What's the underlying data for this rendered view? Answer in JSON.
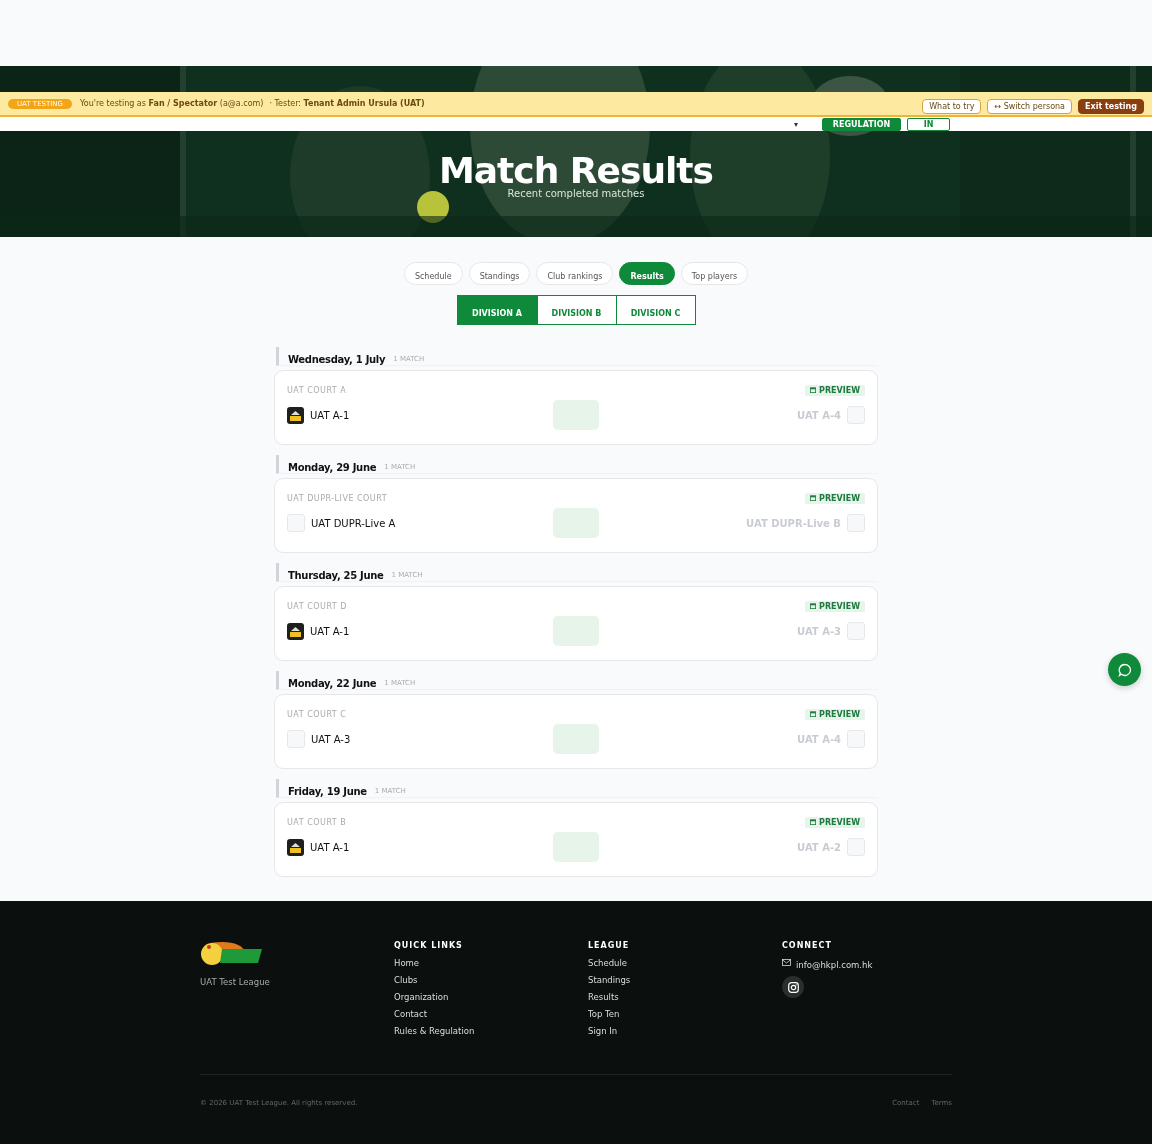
{
  "uat_banner": {
    "badge": "UAT TESTING",
    "message": "You're testing as **Fan / Spectator** (a@a.com)",
    "tester": "· Tester: **Tenant Admin Ursula (UAT)**",
    "buttons": [
      {
        "label": "What to try",
        "kind": "outline"
      },
      {
        "label": "↔ Switch persona",
        "kind": "outline"
      },
      {
        "label": "Exit testing",
        "kind": "solid"
      }
    ]
  },
  "nav": {
    "caret": "▾",
    "buttons": [
      {
        "label": "REGULATION",
        "kind": "solid"
      },
      {
        "label": "IN",
        "kind": "outline"
      }
    ]
  },
  "hero": {
    "title": "Match Results",
    "subtitle": "Recent completed matches"
  },
  "tabs": [
    {
      "label": "Schedule",
      "selected": false
    },
    {
      "label": "Standings",
      "selected": false
    },
    {
      "label": "Club rankings",
      "selected": false
    },
    {
      "label": "Results",
      "selected": true
    },
    {
      "label": "Top players",
      "selected": false
    }
  ],
  "divisions": [
    {
      "label": "DIVISION A",
      "selected": true
    },
    {
      "label": "DIVISION B",
      "selected": false
    },
    {
      "label": "DIVISION C",
      "selected": false
    }
  ],
  "days": [
    {
      "date": "Wednesday, 1 July",
      "count": "1 MATCH",
      "matches": [
        {
          "court": "UAT COURT A",
          "badge": "PREVIEW",
          "home": {
            "name": "UAT A-1",
            "has_logo": true
          },
          "away": {
            "name": "UAT A-4",
            "has_logo": false
          }
        }
      ]
    },
    {
      "date": "Monday, 29 June",
      "count": "1 MATCH",
      "matches": [
        {
          "court": "UAT DUPR-LIVE COURT",
          "badge": "PREVIEW",
          "home": {
            "name": "UAT DUPR-Live A",
            "has_logo": false
          },
          "away": {
            "name": "UAT DUPR-Live B",
            "has_logo": false
          }
        }
      ]
    },
    {
      "date": "Thursday, 25 June",
      "count": "1 MATCH",
      "matches": [
        {
          "court": "UAT COURT D",
          "badge": "PREVIEW",
          "home": {
            "name": "UAT A-1",
            "has_logo": true
          },
          "away": {
            "name": "UAT A-3",
            "has_logo": false
          }
        }
      ]
    },
    {
      "date": "Monday, 22 June",
      "count": "1 MATCH",
      "matches": [
        {
          "court": "UAT COURT C",
          "badge": "PREVIEW",
          "home": {
            "name": "UAT A-3",
            "has_logo": false
          },
          "away": {
            "name": "UAT A-4",
            "has_logo": false
          }
        }
      ]
    },
    {
      "date": "Friday, 19 June",
      "count": "1 MATCH",
      "matches": [
        {
          "court": "UAT COURT B",
          "badge": "PREVIEW",
          "home": {
            "name": "UAT A-1",
            "has_logo": true
          },
          "away": {
            "name": "UAT A-2",
            "has_logo": false
          }
        }
      ]
    }
  ],
  "footer": {
    "league_name": "UAT Test League",
    "columns": [
      {
        "heading": "QUICK LINKS",
        "links": [
          "Home",
          "Clubs",
          "Organization",
          "Contact",
          "Rules & Regulation"
        ]
      },
      {
        "heading": "LEAGUE",
        "links": [
          "Schedule",
          "Standings",
          "Results",
          "Top Ten",
          "Sign In"
        ]
      }
    ],
    "connect": {
      "heading": "CONNECT",
      "email": "info@hkpl.com.hk"
    },
    "copyright": "© 2026 UAT Test League. All rights reserved.",
    "bottom_links": [
      "Contact",
      "Terms"
    ]
  }
}
